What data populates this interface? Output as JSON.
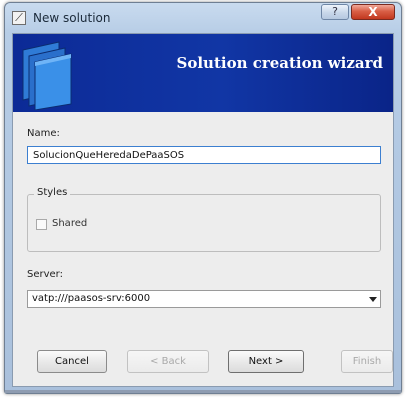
{
  "window": {
    "title": "New solution",
    "help_glyph": "?",
    "close_glyph": "X",
    "icon": "app-window-icon"
  },
  "banner": {
    "title": "Solution creation wizard",
    "logo_icon": "blue-folders-icon",
    "colors": {
      "start": "#0c2a96",
      "end": "#0a2488"
    }
  },
  "form": {
    "name_label": "Name:",
    "name_value": "SolucionQueHeredaDePaaSOS",
    "styles_group_label": "Styles",
    "shared_label": "Shared",
    "shared_checked": false,
    "server_label": "Server:",
    "server_value": "vatp:///paasos-srv:6000"
  },
  "buttons": {
    "cancel": "Cancel",
    "back": "< Back",
    "next": "Next >",
    "finish": "Finish"
  },
  "colors": {
    "accent_focus": "#3c7fd0",
    "close_button": "#d95f46"
  }
}
